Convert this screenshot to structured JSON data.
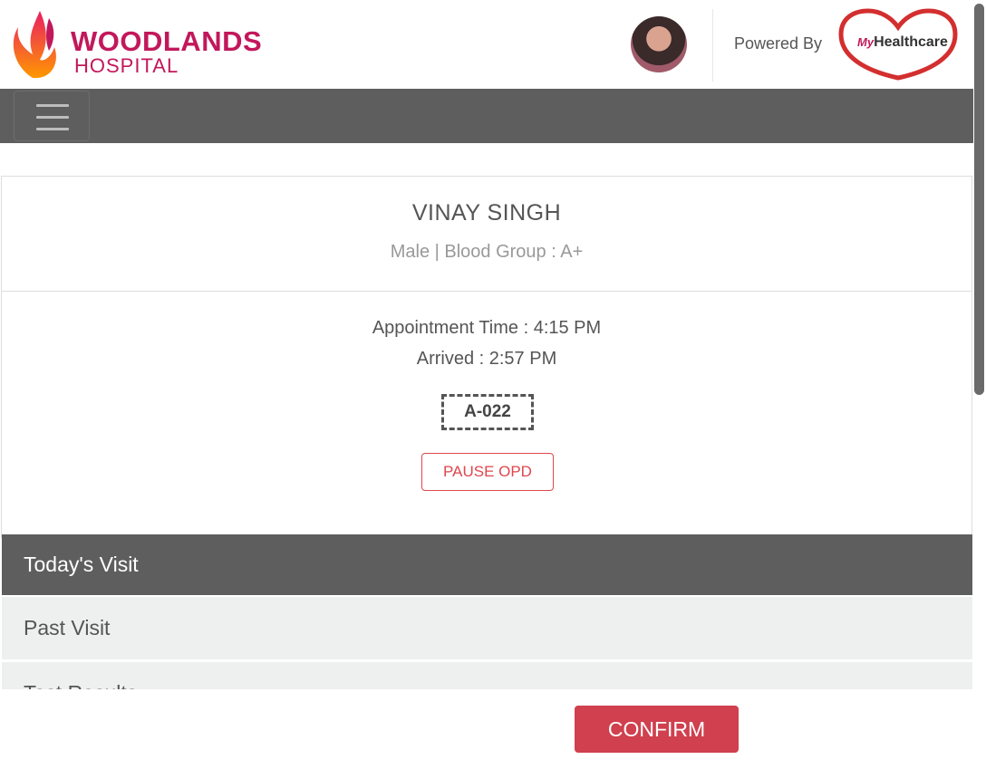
{
  "header": {
    "logo_title": "WOODLANDS",
    "logo_subtitle": "HOSPITAL",
    "powered_by": "Powered By",
    "partner_logo_prefix": "My",
    "partner_logo_name": "Healthcare"
  },
  "navbar": {
    "menu_icon": "hamburger-menu-icon"
  },
  "patient": {
    "name": "VINAY SINGH",
    "info": "Male | Blood Group : A+",
    "appointment_time": "Appointment Time : 4:15 PM",
    "arrived": "Arrived : 2:57 PM",
    "token": "A-022",
    "pause_label": "PAUSE OPD"
  },
  "tabs": [
    {
      "label": "Today's Visit",
      "active": true
    },
    {
      "label": "Past Visit",
      "active": false
    },
    {
      "label": "Test Results",
      "active": false
    }
  ],
  "footer": {
    "confirm_label": "CONFIRM"
  },
  "colors": {
    "brand": "#c2185b",
    "navbar": "#5e5e5e",
    "accent_red": "#d0404e"
  }
}
